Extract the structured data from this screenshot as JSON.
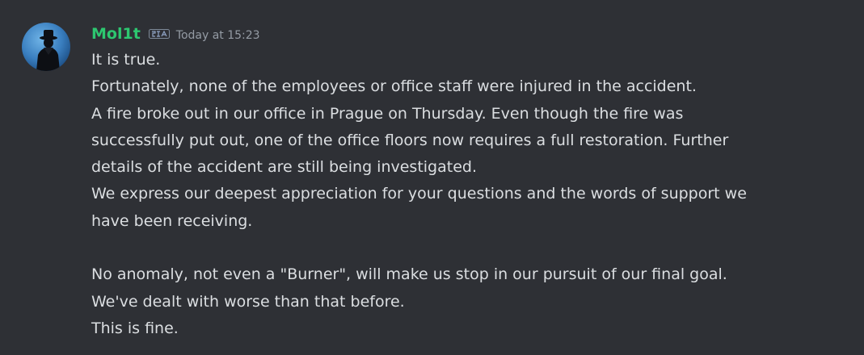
{
  "message": {
    "author": "Mol1t",
    "timestamp": "Today at 15:23",
    "author_color": "#2dc770",
    "lines": [
      "It is true.",
      "Fortunately, none of the employees or office staff were injured in the accident.",
      "A fire broke out in our office in Prague on Thursday. Even though the fire was",
      "successfully put out, one of the office floors now requires a full restoration. Further",
      "details of the accident are still being investigated.",
      "We express our deepest appreciation for your questions and the words of support we",
      "have been receiving.",
      "",
      "No anomaly, not even a \"Burner\", will make us stop in our pursuit of our final goal.",
      "We've dealt with worse than that before.",
      "This is fine."
    ]
  },
  "icons": {
    "avatar": "silhouette-avatar",
    "clan_tag": "clan-tag-icon"
  },
  "colors": {
    "background": "#2e3035",
    "text": "#dbdee1",
    "timestamp": "#949ba4"
  }
}
